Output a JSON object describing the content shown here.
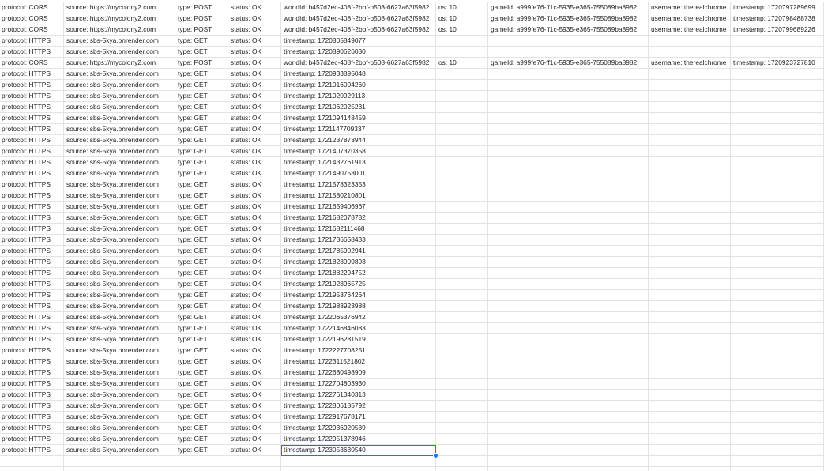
{
  "colors": {
    "gridline": "#e2e3e3",
    "selection": "#1a73e8",
    "text": "#222222"
  },
  "selected_cell": {
    "row": 40,
    "col": 4
  },
  "rows": [
    [
      "protocol: CORS",
      "source: https://mycolony2.com",
      "type: POST",
      "status: OK",
      "worldId: b457d2ec-408f-2bbf-b508-6627a63f5982",
      "os: 10",
      "gameId: a999fe76-ff1c-5935-e365-755089ba8982",
      "username: therealchrome",
      "timestamp: 1720797289699"
    ],
    [
      "protocol: CORS",
      "source: https://mycolony2.com",
      "type: POST",
      "status: OK",
      "worldId: b457d2ec-408f-2bbf-b508-6627a63f5982",
      "os: 10",
      "gameId: a999fe76-ff1c-5935-e365-755089ba8982",
      "username: therealchrome",
      "timestamp: 1720798488738"
    ],
    [
      "protocol: CORS",
      "source: https://mycolony2.com",
      "type: POST",
      "status: OK",
      "worldId: b457d2ec-408f-2bbf-b508-6627a63f5982",
      "os: 10",
      "gameId: a999fe76-ff1c-5935-e365-755089ba8982",
      "username: therealchrome",
      "timestamp: 1720799689226"
    ],
    [
      "protocol: HTTPS",
      "source: sbs-5kya.onrender.com",
      "type: GET",
      "status: OK",
      "timestamp: 1720805849077",
      "",
      "",
      "",
      ""
    ],
    [
      "protocol: HTTPS",
      "source: sbs-5kya.onrender.com",
      "type: GET",
      "status: OK",
      "timestamp: 1720890626030",
      "",
      "",
      "",
      ""
    ],
    [
      "protocol: CORS",
      "source: https://mycolony2.com",
      "type: POST",
      "status: OK",
      "worldId: b457d2ec-408f-2bbf-b508-6627a63f5982",
      "os: 10",
      "gameId: a999fe76-ff1c-5935-e365-755089ba8982",
      "username: therealchrome",
      "timestamp: 1720923727810"
    ],
    [
      "protocol: HTTPS",
      "source: sbs-5kya.onrender.com",
      "type: GET",
      "status: OK",
      "timestamp: 1720933895048",
      "",
      "",
      "",
      ""
    ],
    [
      "protocol: HTTPS",
      "source: sbs-5kya.onrender.com",
      "type: GET",
      "status: OK",
      "timestamp: 1721016004260",
      "",
      "",
      "",
      ""
    ],
    [
      "protocol: HTTPS",
      "source: sbs-5kya.onrender.com",
      "type: GET",
      "status: OK",
      "timestamp: 1721020929113",
      "",
      "",
      "",
      ""
    ],
    [
      "protocol: HTTPS",
      "source: sbs-5kya.onrender.com",
      "type: GET",
      "status: OK",
      "timestamp: 1721062025231",
      "",
      "",
      "",
      ""
    ],
    [
      "protocol: HTTPS",
      "source: sbs-5kya.onrender.com",
      "type: GET",
      "status: OK",
      "timestamp: 1721094148459",
      "",
      "",
      "",
      ""
    ],
    [
      "protocol: HTTPS",
      "source: sbs-5kya.onrender.com",
      "type: GET",
      "status: OK",
      "timestamp: 1721147709337",
      "",
      "",
      "",
      ""
    ],
    [
      "protocol: HTTPS",
      "source: sbs-5kya.onrender.com",
      "type: GET",
      "status: OK",
      "timestamp: 1721237873944",
      "",
      "",
      "",
      ""
    ],
    [
      "protocol: HTTPS",
      "source: sbs-5kya.onrender.com",
      "type: GET",
      "status: OK",
      "timestamp: 1721407370358",
      "",
      "",
      "",
      ""
    ],
    [
      "protocol: HTTPS",
      "source: sbs-5kya.onrender.com",
      "type: GET",
      "status: OK",
      "timestamp: 1721432761913",
      "",
      "",
      "",
      ""
    ],
    [
      "protocol: HTTPS",
      "source: sbs-5kya.onrender.com",
      "type: GET",
      "status: OK",
      "timestamp: 1721490753001",
      "",
      "",
      "",
      ""
    ],
    [
      "protocol: HTTPS",
      "source: sbs-5kya.onrender.com",
      "type: GET",
      "status: OK",
      "timestamp: 1721578323353",
      "",
      "",
      "",
      ""
    ],
    [
      "protocol: HTTPS",
      "source: sbs-5kya.onrender.com",
      "type: GET",
      "status: OK",
      "timestamp: 1721580210801",
      "",
      "",
      "",
      ""
    ],
    [
      "protocol: HTTPS",
      "source: sbs-5kya.onrender.com",
      "type: GET",
      "status: OK",
      "timestamp: 1721659406967",
      "",
      "",
      "",
      ""
    ],
    [
      "protocol: HTTPS",
      "source: sbs-5kya.onrender.com",
      "type: GET",
      "status: OK",
      "timestamp: 1721682078782",
      "",
      "",
      "",
      ""
    ],
    [
      "protocol: HTTPS",
      "source: sbs-5kya.onrender.com",
      "type: GET",
      "status: OK",
      "timestamp: 1721682111468",
      "",
      "",
      "",
      ""
    ],
    [
      "protocol: HTTPS",
      "source: sbs-5kya.onrender.com",
      "type: GET",
      "status: OK",
      "timestamp: 1721736658433",
      "",
      "",
      "",
      ""
    ],
    [
      "protocol: HTTPS",
      "source: sbs-5kya.onrender.com",
      "type: GET",
      "status: OK",
      "timestamp: 1721785902941",
      "",
      "",
      "",
      ""
    ],
    [
      "protocol: HTTPS",
      "source: sbs-5kya.onrender.com",
      "type: GET",
      "status: OK",
      "timestamp: 1721828909893",
      "",
      "",
      "",
      ""
    ],
    [
      "protocol: HTTPS",
      "source: sbs-5kya.onrender.com",
      "type: GET",
      "status: OK",
      "timestamp: 1721882294752",
      "",
      "",
      "",
      ""
    ],
    [
      "protocol: HTTPS",
      "source: sbs-5kya.onrender.com",
      "type: GET",
      "status: OK",
      "timestamp: 1721928965725",
      "",
      "",
      "",
      ""
    ],
    [
      "protocol: HTTPS",
      "source: sbs-5kya.onrender.com",
      "type: GET",
      "status: OK",
      "timestamp: 1721953764264",
      "",
      "",
      "",
      ""
    ],
    [
      "protocol: HTTPS",
      "source: sbs-5kya.onrender.com",
      "type: GET",
      "status: OK",
      "timestamp: 1721983923988",
      "",
      "",
      "",
      ""
    ],
    [
      "protocol: HTTPS",
      "source: sbs-5kya.onrender.com",
      "type: GET",
      "status: OK",
      "timestamp: 1722065376942",
      "",
      "",
      "",
      ""
    ],
    [
      "protocol: HTTPS",
      "source: sbs-5kya.onrender.com",
      "type: GET",
      "status: OK",
      "timestamp: 1722146846083",
      "",
      "",
      "",
      ""
    ],
    [
      "protocol: HTTPS",
      "source: sbs-5kya.onrender.com",
      "type: GET",
      "status: OK",
      "timestamp: 1722196281519",
      "",
      "",
      "",
      ""
    ],
    [
      "protocol: HTTPS",
      "source: sbs-5kya.onrender.com",
      "type: GET",
      "status: OK",
      "timestamp: 1722227708251",
      "",
      "",
      "",
      ""
    ],
    [
      "protocol: HTTPS",
      "source: sbs-5kya.onrender.com",
      "type: GET",
      "status: OK",
      "timestamp: 1722311521802",
      "",
      "",
      "",
      ""
    ],
    [
      "protocol: HTTPS",
      "source: sbs-5kya.onrender.com",
      "type: GET",
      "status: OK",
      "timestamp: 1722680498909",
      "",
      "",
      "",
      ""
    ],
    [
      "protocol: HTTPS",
      "source: sbs-5kya.onrender.com",
      "type: GET",
      "status: OK",
      "timestamp: 1722704803930",
      "",
      "",
      "",
      ""
    ],
    [
      "protocol: HTTPS",
      "source: sbs-5kya.onrender.com",
      "type: GET",
      "status: OK",
      "timestamp: 1722761340313",
      "",
      "",
      "",
      ""
    ],
    [
      "protocol: HTTPS",
      "source: sbs-5kya.onrender.com",
      "type: GET",
      "status: OK",
      "timestamp: 1722806185792",
      "",
      "",
      "",
      ""
    ],
    [
      "protocol: HTTPS",
      "source: sbs-5kya.onrender.com",
      "type: GET",
      "status: OK",
      "timestamp: 1722917678171",
      "",
      "",
      "",
      ""
    ],
    [
      "protocol: HTTPS",
      "source: sbs-5kya.onrender.com",
      "type: GET",
      "status: OK",
      "timestamp: 1722936920589",
      "",
      "",
      "",
      ""
    ],
    [
      "protocol: HTTPS",
      "source: sbs-5kya.onrender.com",
      "type: GET",
      "status: OK",
      "timestamp: 1722951378946",
      "",
      "",
      "",
      ""
    ],
    [
      "protocol: HTTPS",
      "source: sbs-5kya.onrender.com",
      "type: GET",
      "status: OK",
      "timestamp: 1723053630540",
      "",
      "",
      "",
      ""
    ],
    [
      "",
      "",
      "",
      "",
      "",
      "",
      "",
      "",
      ""
    ],
    [
      "",
      "",
      "",
      "",
      "",
      "",
      "",
      "",
      ""
    ]
  ]
}
